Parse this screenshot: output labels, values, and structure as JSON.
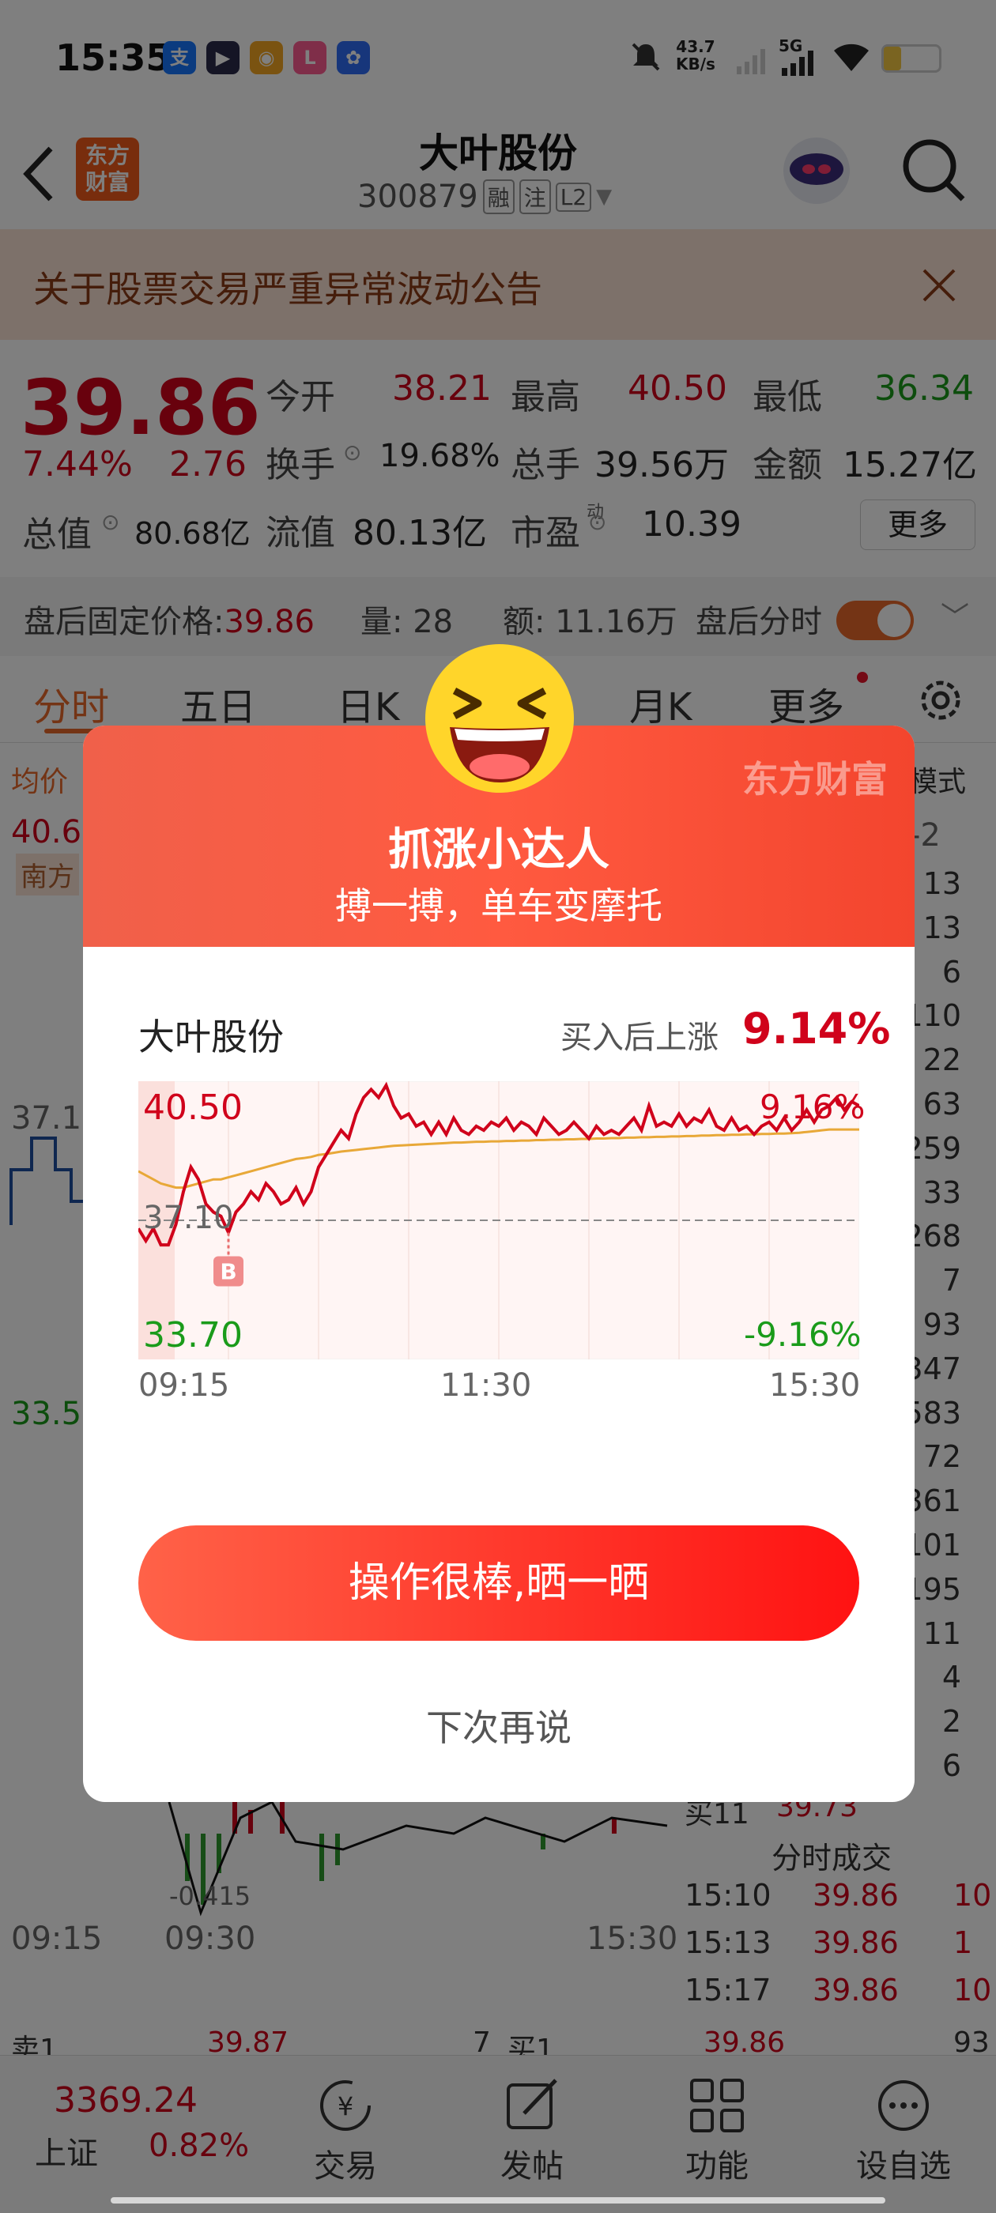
{
  "status_bar": {
    "time": "15:35",
    "net_speed": "43.7",
    "net_speed_unit": "KB/s",
    "signal_label": "5G",
    "app_icons": [
      {
        "name": "alipay-icon",
        "glyph": "支",
        "color": "#1677ff"
      },
      {
        "name": "video-app-icon",
        "glyph": "▶",
        "color": "#2a2a4a"
      },
      {
        "name": "weibo-icon",
        "glyph": "◉",
        "color": "#f5a623"
      },
      {
        "name": "lofter-app-icon",
        "glyph": "L",
        "color": "#ff5c93"
      },
      {
        "name": "baidu-icon",
        "glyph": "✿",
        "color": "#2f6cf6"
      }
    ]
  },
  "header": {
    "logo_line1": "东方",
    "logo_line2": "财富",
    "title": "大叶股份",
    "code": "300879",
    "badge1": "融",
    "badge2": "注",
    "badge3": "L2"
  },
  "notice": {
    "text": "关于股票交易严重异常波动公告"
  },
  "quote": {
    "price": "39.86",
    "change_pct": "7.44%",
    "change": "2.76",
    "open_label": "今开",
    "open": "38.21",
    "high_label": "最高",
    "high": "40.50",
    "low_label": "最低",
    "low": "36.34",
    "turnover_label": "换手",
    "turnover": "19.68%",
    "volume_label": "总手",
    "volume": "39.56万",
    "amount_label": "金额",
    "amount": "15.27亿",
    "mktcap_label": "总值",
    "mktcap": "80.68亿",
    "float_label": "流值",
    "float": "80.13亿",
    "pe_label": "市盈",
    "pe_sup": "动",
    "pe": "10.39",
    "more": "更多"
  },
  "after_hours": {
    "price_label": "盘后固定价格:",
    "price": "39.86",
    "vol_label": "量:",
    "vol": "28",
    "amt_label": "额:",
    "amt": "11.16万",
    "toggle_label": "盘后分时"
  },
  "tabs": [
    "分时",
    "五日",
    "日K",
    "月K",
    "更多"
  ],
  "background_chart": {
    "avg_label": "均价",
    "mode_label": "模式",
    "top_price": "40.6",
    "south_label": "南方",
    "mid_price": "37.16",
    "low_price": "33.5",
    "neg_label": "-2",
    "macd_label": "-0.415",
    "time_start": "09:15",
    "time_open": "09:30",
    "time_end": "15:30",
    "order_volumes": [
      "13",
      "13",
      "6",
      "110",
      "22",
      "63",
      "259",
      "33",
      "268",
      "7",
      "93",
      "347",
      "583",
      "72",
      "361",
      "101",
      "195",
      "11",
      "4",
      "2",
      "6"
    ],
    "buy11_label": "买11",
    "buy11_price": "39.73",
    "ticks_title": "分时成交",
    "ticks": [
      {
        "time": "15:10",
        "price": "39.86",
        "vol": "10"
      },
      {
        "time": "15:13",
        "price": "39.86",
        "vol": "1"
      },
      {
        "time": "15:17",
        "price": "39.86",
        "vol": "10"
      }
    ],
    "sell1_label": "卖1",
    "sell1_price": "39.87",
    "sell1_vol": "7",
    "buy1_label": "买1",
    "buy1_price": "39.86",
    "buy1_vol": "93"
  },
  "bottom_nav": {
    "index_value": "3369.24",
    "index_name": "上证",
    "index_pct": "0.82%",
    "items": [
      "交易",
      "发帖",
      "功能",
      "设自选"
    ]
  },
  "modal": {
    "brand": "东方财富",
    "title": "抓涨小达人",
    "subtitle": "搏一搏，单车变摩托",
    "stock_name": "大叶股份",
    "gain_label": "买入后上涨",
    "gain_value": "9.14%",
    "share_button": "操作很棒,晒一晒",
    "later_button": "下次再说"
  },
  "chart_data": {
    "type": "line",
    "title": "",
    "xlabel": "",
    "ylabel": "",
    "x_ticks": [
      "09:15",
      "11:30",
      "15:30"
    ],
    "ylim": [
      33.7,
      40.5
    ],
    "y_left_labels": [
      "40.50",
      "37.10",
      "33.70"
    ],
    "y_right_labels": [
      "9.16%",
      "-9.16%"
    ],
    "buy_marker": {
      "label": "B",
      "index": 12
    },
    "series": [
      {
        "color": "#d0021b",
        "values": [
          36.9,
          36.6,
          36.9,
          36.5,
          36.5,
          37.0,
          37.8,
          38.4,
          38.1,
          37.5,
          37.3,
          37.2,
          36.8,
          37.3,
          37.5,
          37.8,
          37.6,
          38.0,
          37.8,
          37.5,
          37.6,
          37.9,
          37.5,
          37.8,
          38.4,
          38.7,
          39.0,
          39.3,
          39.1,
          39.7,
          40.1,
          40.3,
          40.1,
          40.4,
          39.9,
          39.6,
          39.7,
          39.4,
          39.5,
          39.2,
          39.5,
          39.2,
          39.6,
          39.3,
          39.2,
          39.4,
          39.3,
          39.5,
          39.4,
          39.6,
          39.3,
          39.5,
          39.4,
          39.2,
          39.6,
          39.4,
          39.2,
          39.3,
          39.5,
          39.3,
          39.1,
          39.4,
          39.2,
          39.3,
          39.2,
          39.4,
          39.6,
          39.3,
          39.9,
          39.4,
          39.5,
          39.4,
          39.7,
          39.4,
          39.6,
          39.5,
          39.8,
          39.4,
          39.3,
          39.6,
          39.3,
          39.4,
          39.2,
          39.4,
          39.5,
          39.3,
          39.6,
          39.3,
          39.5,
          39.8,
          39.5,
          39.8,
          39.9,
          40.1,
          39.8,
          40.0,
          39.9
        ]
      },
      {
        "color": "#e8a838",
        "values": [
          38.3,
          38.2,
          38.1,
          38.0,
          37.95,
          37.9,
          37.9,
          37.95,
          38.0,
          38.05,
          38.1,
          38.1,
          38.15,
          38.2,
          38.25,
          38.3,
          38.35,
          38.4,
          38.45,
          38.5,
          38.55,
          38.6,
          38.62,
          38.65,
          38.7,
          38.72,
          38.75,
          38.78,
          38.8,
          38.82,
          38.84,
          38.86,
          38.88,
          38.9,
          38.92,
          38.93,
          38.94,
          38.95,
          38.96,
          38.97,
          38.98,
          38.99,
          39.0,
          39.0,
          39.01,
          39.02,
          39.02,
          39.03,
          39.03,
          39.04,
          39.04,
          39.05,
          39.05,
          39.06,
          39.06,
          39.07,
          39.07,
          39.08,
          39.08,
          39.09,
          39.09,
          39.1,
          39.1,
          39.11,
          39.11,
          39.12,
          39.12,
          39.13,
          39.13,
          39.14,
          39.14,
          39.15,
          39.15,
          39.16,
          39.16,
          39.17,
          39.17,
          39.18,
          39.18,
          39.19,
          39.19,
          39.2,
          39.2,
          39.21,
          39.21,
          39.22,
          39.22,
          39.23,
          39.24,
          39.26,
          39.28,
          39.3,
          39.32,
          39.32,
          39.32,
          39.32,
          39.32
        ]
      }
    ]
  }
}
